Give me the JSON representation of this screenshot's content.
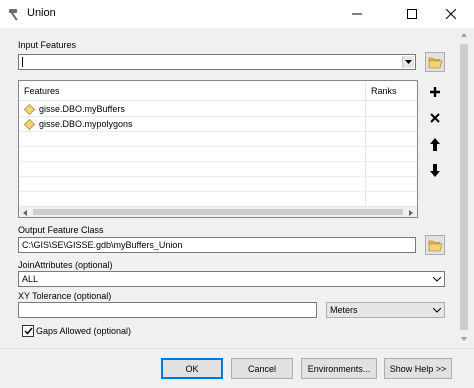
{
  "window": {
    "title": "Union"
  },
  "input_features": {
    "label": "Input Features",
    "value": ""
  },
  "features_list": {
    "columns": [
      "Features",
      "Ranks"
    ],
    "items": [
      {
        "name": "gisse.DBO.myBuffers",
        "rank": ""
      },
      {
        "name": "gisse.DBO.mypolygons",
        "rank": ""
      }
    ]
  },
  "output_feature_class": {
    "label": "Output Feature Class",
    "value": "C:\\GIS\\SE\\GISSE.gdb\\myBuffers_Union"
  },
  "join_attributes": {
    "label": "JoinAttributes (optional)",
    "value": "ALL"
  },
  "xy_tolerance": {
    "label": "XY Tolerance (optional)",
    "value": "",
    "unit": "Meters"
  },
  "gaps_allowed": {
    "label": "Gaps Allowed (optional)",
    "checked": true
  },
  "buttons": {
    "ok": "OK",
    "cancel": "Cancel",
    "environments": "Environments...",
    "show_help": "Show Help >>"
  },
  "icons": {
    "title": "hammer-icon",
    "add": "plus-icon",
    "remove": "x-icon",
    "up": "arrow-up-icon",
    "down": "arrow-down-icon",
    "browse": "folder-open-icon",
    "layer": "diamond-layer-icon"
  }
}
